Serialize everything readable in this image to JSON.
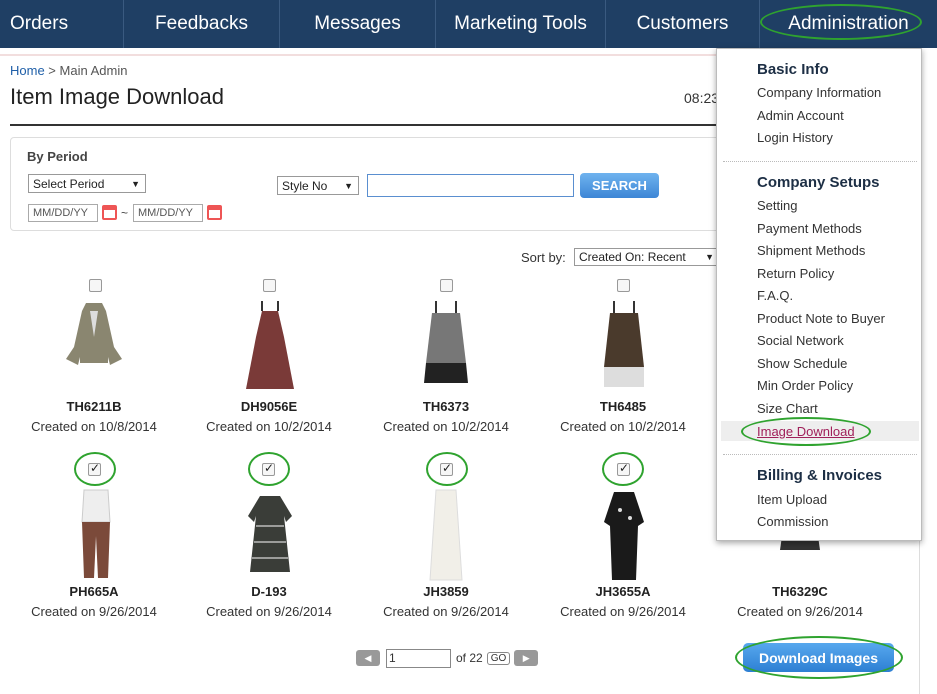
{
  "nav": {
    "items": [
      "Orders",
      "Feedbacks",
      "Messages",
      "Marketing Tools",
      "Customers",
      "Administration"
    ]
  },
  "breadcrumb": {
    "home": "Home",
    "separator": " > ",
    "current": "Main Admin"
  },
  "page": {
    "title": "Item Image Download",
    "clock": "08:23"
  },
  "filter": {
    "by_period": "By Period",
    "period_select": "Select Period",
    "date_from_placeholder": "MM/DD/YY",
    "date_to_placeholder": "MM/DD/YY",
    "tilde": "~",
    "field_select": "Style No",
    "search_value": "",
    "search_button": "SEARCH"
  },
  "sort": {
    "label": "Sort by:",
    "value": "Created On: Recent"
  },
  "items": [
    {
      "sku": "TH6211B",
      "created": "Created on 10/8/2014",
      "checked": false
    },
    {
      "sku": "DH9056E",
      "created": "Created on 10/2/2014",
      "checked": false
    },
    {
      "sku": "TH6373",
      "created": "Created on 10/2/2014",
      "checked": false
    },
    {
      "sku": "TH6485",
      "created": "Created on 10/2/2014",
      "checked": false
    },
    {
      "sku": "PH665A",
      "created": "Created on 9/26/2014",
      "checked": true
    },
    {
      "sku": "D-193",
      "created": "Created on 9/26/2014",
      "checked": true
    },
    {
      "sku": "JH3859",
      "created": "Created on 9/26/2014",
      "checked": true
    },
    {
      "sku": "JH3655A",
      "created": "Created on 9/26/2014",
      "checked": true
    },
    {
      "sku": "TH6329C",
      "created": "Created on 9/26/2014",
      "checked": false
    }
  ],
  "pager": {
    "page": "1",
    "of": "of 22",
    "go": "GO"
  },
  "download_button": "Download Images",
  "admin_menu": {
    "sections": [
      {
        "title": "Basic Info",
        "items": [
          "Company Information",
          "Admin Account",
          "Login History"
        ]
      },
      {
        "title": "Company Setups",
        "items": [
          "Setting",
          "Payment Methods",
          "Shipment Methods",
          "Return Policy",
          "F.A.Q.",
          "Product Note to Buyer",
          "Social Network",
          "Show Schedule",
          "Min Order Policy",
          "Size Chart",
          "Image Download"
        ]
      },
      {
        "title": "Billing & Invoices",
        "items": [
          "Item Upload",
          "Commission"
        ]
      }
    ]
  },
  "colors": {
    "nav_bg": "#1f3f64",
    "highlight_ring": "#2fa32f",
    "button_blue": "#3d86d6",
    "link_selected": "#a0205a"
  }
}
